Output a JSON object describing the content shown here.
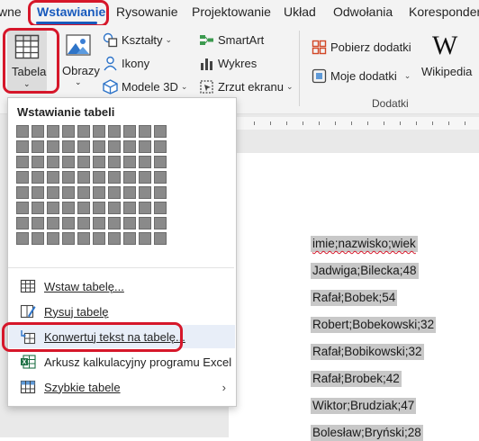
{
  "tabs": [
    {
      "label": "wne"
    },
    {
      "label": "Wstawianie",
      "active": true
    },
    {
      "label": "Rysowanie"
    },
    {
      "label": "Projektowanie"
    },
    {
      "label": "Układ"
    },
    {
      "label": "Odwołania"
    },
    {
      "label": "Koresponder"
    }
  ],
  "ribbon": {
    "table_label": "Tabela",
    "images_label": "Obrazy",
    "shapes_label": "Kształty",
    "icons_label": "Ikony",
    "models3d_label": "Modele 3D",
    "smartart_label": "SmartArt",
    "chart_label": "Wykres",
    "screenshot_label": "Zrzut ekranu",
    "get_addins_label": "Pobierz dodatki",
    "my_addins_label": "Moje dodatki",
    "wikipedia_label": "Wikipedia",
    "addins_group_label": "Dodatki"
  },
  "dropdown": {
    "title": "Wstawianie tabeli",
    "grid": {
      "columns": 10,
      "rows": 8
    },
    "items": [
      {
        "label": "Wstaw tabelę..."
      },
      {
        "label": "Rysuj tabelę"
      },
      {
        "label": "Konwertuj tekst na tabelę..."
      },
      {
        "label": "Arkusz kalkulacyjny programu Excel"
      },
      {
        "label": "Szybkie tabele",
        "has_submenu": true
      }
    ]
  },
  "document": {
    "lines": [
      "imie;nazwisko;wiek",
      "Jadwiga;Bilecka;48",
      "Rafał;Bobek;54",
      "Robert;Bobekowski;32",
      "Rafał;Bobikowski;32",
      "Rafał;Brobek;42",
      "Wiktor;Brudziak;47",
      "Bolesław;Bryński;28"
    ]
  },
  "colors": {
    "accent": "#185abd",
    "annotation_red": "#d6172a",
    "selection": "#c8c8c8",
    "hover": "#e8eef8"
  }
}
